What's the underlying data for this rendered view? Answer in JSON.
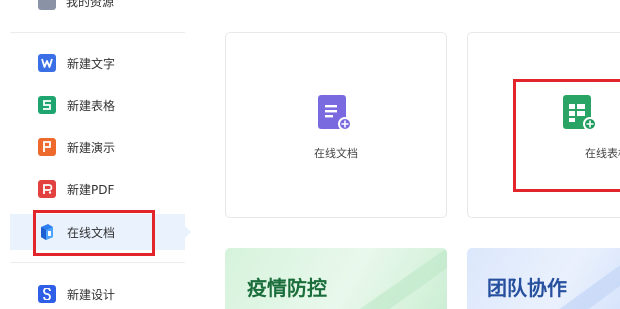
{
  "sidebar": {
    "top_item": {
      "label": "我的资源",
      "icon": "folder-icon"
    },
    "items": [
      {
        "label": "新建文字",
        "icon": "doc-w-icon",
        "glyph": "W",
        "color": "#3a6fe6"
      },
      {
        "label": "新建表格",
        "icon": "sheet-s-icon",
        "glyph": "S",
        "color": "#1fa56f"
      },
      {
        "label": "新建演示",
        "icon": "slides-p-icon",
        "glyph": "P",
        "color": "#ee6a2c"
      },
      {
        "label": "新建PDF",
        "icon": "pdf-icon",
        "glyph": "P",
        "color": "#e2413f"
      },
      {
        "label": "在线文档",
        "icon": "online-doc-icon",
        "glyph": "▮",
        "color": "#2f7ef0",
        "active": true
      },
      {
        "label": "新建设计",
        "icon": "design-icon",
        "glyph": "S",
        "color": "#2f5fe6"
      }
    ]
  },
  "cards": [
    {
      "label": "在线文档",
      "icon": "online-doc-add-icon",
      "color": "#7a6ae0",
      "plus_color": "#1b9a5b"
    },
    {
      "label": "在线表格",
      "icon": "online-sheet-add-icon",
      "color": "#2aa465",
      "plus_color": "#1b9a5b"
    }
  ],
  "banners": [
    {
      "label": "疫情防控",
      "text_color": "#1b6e3c"
    },
    {
      "label": "团队协作",
      "text_color": "#264f9e"
    }
  ],
  "colors": {
    "highlight": "#e2242b",
    "active_bg": "#eaf2fe"
  }
}
